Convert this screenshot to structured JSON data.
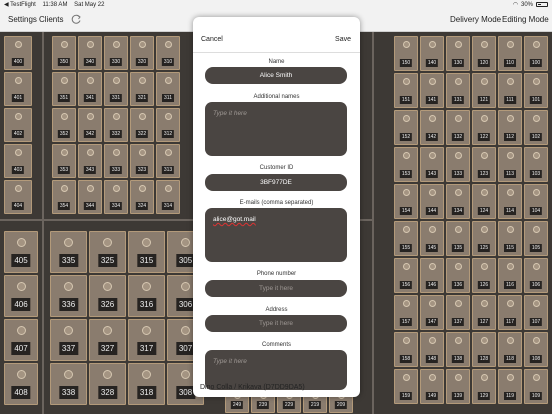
{
  "status_bar": {
    "carrier": "◀ TestFlight",
    "time": "11:38 AM",
    "date": "Sat May 22",
    "battery": "30%"
  },
  "nav": {
    "settings": "Settings",
    "clients": "Clients",
    "delivery_mode": "Delivery Mode",
    "editing_mode": "Editing Mode"
  },
  "lockers": {
    "col_400": [
      "400",
      "401",
      "402",
      "403",
      "404"
    ],
    "cols_350": [
      [
        "350",
        "351",
        "352",
        "353",
        "354"
      ],
      [
        "340",
        "341",
        "342",
        "343",
        "344"
      ],
      [
        "330",
        "331",
        "332",
        "333",
        "334"
      ],
      [
        "320",
        "321",
        "322",
        "323",
        "324"
      ],
      [
        "310",
        "311",
        "312",
        "313",
        "314"
      ]
    ],
    "big_left": [
      "405",
      "406",
      "407",
      "408"
    ],
    "big_cols": [
      [
        "335",
        "336",
        "337",
        "338"
      ],
      [
        "325",
        "326",
        "327",
        "328"
      ],
      [
        "315",
        "316",
        "317",
        "318"
      ],
      [
        "305",
        "306",
        "307",
        "308"
      ]
    ],
    "right_cols": [
      [
        "150",
        "151",
        "152",
        "153",
        "154",
        "155",
        "156",
        "157",
        "158",
        "159"
      ],
      [
        "140",
        "141",
        "142",
        "143",
        "144",
        "145",
        "146",
        "147",
        "148",
        "149"
      ],
      [
        "130",
        "131",
        "132",
        "133",
        "134",
        "135",
        "136",
        "137",
        "138",
        "139"
      ],
      [
        "120",
        "121",
        "122",
        "123",
        "124",
        "125",
        "126",
        "127",
        "128",
        "129"
      ],
      [
        "110",
        "111",
        "112",
        "113",
        "114",
        "115",
        "116",
        "117",
        "118",
        "119"
      ],
      [
        "100",
        "101",
        "102",
        "103",
        "104",
        "105",
        "106",
        "107",
        "108",
        "109"
      ]
    ],
    "bottom_strip": [
      "249",
      "239",
      "229",
      "219",
      "209"
    ]
  },
  "modal": {
    "cancel": "Cancel",
    "save": "Save",
    "fields": {
      "name": {
        "label": "Name",
        "value": "Alice Smith"
      },
      "additional_names": {
        "label": "Additional names",
        "placeholder": "Type it here"
      },
      "customer_id": {
        "label": "Customer ID",
        "value": "3BF977DE"
      },
      "emails": {
        "label": "E-mails (comma separated)",
        "value": "alice@got.mail"
      },
      "phone": {
        "label": "Phone number",
        "placeholder": "Type it here"
      },
      "address": {
        "label": "Address",
        "placeholder": "Type it here"
      },
      "comments": {
        "label": "Comments",
        "placeholder": "Type it here"
      }
    }
  },
  "footer": {
    "location": "Dino Colla / Krikava (D7DD9DA5)"
  }
}
